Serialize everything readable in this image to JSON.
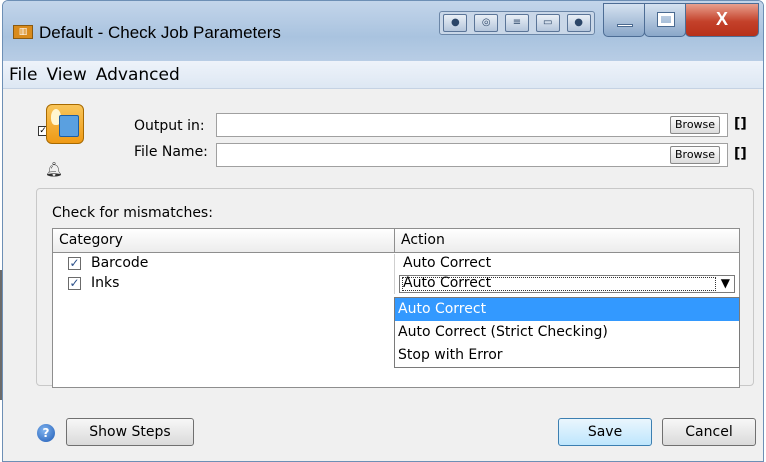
{
  "window": {
    "title": "Default - Check Job Parameters",
    "title_icon": "app-icon",
    "toolbar_icons": [
      "record-icon",
      "camera-icon",
      "filter-icon",
      "window-icon",
      "record-icon"
    ],
    "controls": [
      "minimize-icon",
      "maximize-icon",
      "close-icon"
    ],
    "close_glyph": "X"
  },
  "menu": [
    "File",
    "View",
    "Advanced"
  ],
  "job": {
    "enabled_mark": "✓",
    "icon": "job-icon",
    "bell_icon": "bell-icon"
  },
  "fields": {
    "output_label": "Output in:",
    "output_value": "",
    "file_label": "File Name:",
    "file_value": "",
    "browse_label": "Browse",
    "brackets": "[]"
  },
  "mismatch": {
    "title": "Check for mismatches:",
    "headers": {
      "category": "Category",
      "action": "Action"
    },
    "rows": [
      {
        "checked": true,
        "category": "Barcode",
        "action": "Auto Correct"
      },
      {
        "checked": true,
        "category": "Inks",
        "action": "Auto Correct"
      }
    ],
    "dropdown_options": [
      "Auto Correct",
      "Auto Correct (Strict Checking)",
      "Stop with Error"
    ],
    "dropdown_selected": "Auto Correct",
    "check_mark": "✓",
    "dropdown_arrow": "▼"
  },
  "footer": {
    "help_icon": "?",
    "show_steps": "Show Steps",
    "save": "Save",
    "cancel": "Cancel"
  },
  "colors": {
    "selection": "#3399ff",
    "titlebar": "#a9c3df",
    "close": "#c4412a"
  }
}
